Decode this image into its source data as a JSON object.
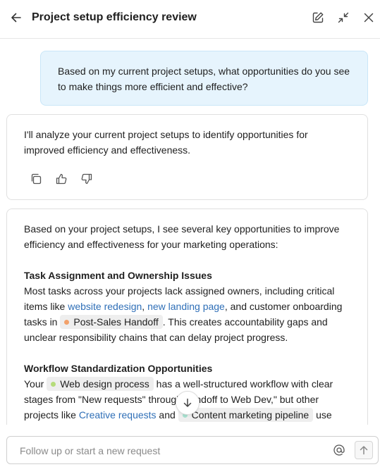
{
  "header": {
    "title": "Project setup efficiency review"
  },
  "user_message": {
    "text": "Based on my current project setups, what opportunities do you see to make things more efficient and effective?"
  },
  "ai_message_1": {
    "text": "I'll analyze your current project setups to identify opportunities for improved efficiency and effectiveness."
  },
  "ai_message_2": {
    "intro": "Based on your project setups, I see several key opportunities to improve efficiency and effectiveness for your marketing operations:",
    "section1": {
      "heading": "Task Assignment and Ownership Issues",
      "t1": "Most tasks across your projects lack assigned owners, including critical items like ",
      "link1": "website redesign",
      "t2": ", ",
      "link2": "new landing page",
      "t3": ", and customer onboarding tasks in ",
      "chip1": "Post-Sales Handoff",
      "t4": ". This creates accountability gaps and unclear responsibility chains that can delay project progress."
    },
    "section2": {
      "heading": "Workflow Standardization Opportunities",
      "t1": "Your ",
      "chip1": "Web design process",
      "t2": " has a well-structured workflow with clear stages from \"New requests\" through handoff to Web Dev,\" but other projects like ",
      "link1": "Creative requests",
      "t3": " and ",
      "chip2": "Content marketing pipeline",
      "t4": " use"
    }
  },
  "composer": {
    "placeholder": "Follow up or start a new request"
  },
  "colors": {
    "user_bubble_bg": "#e6f4fd",
    "link": "#2f6fb7",
    "chip_post_sales_dot": "#f2a16b",
    "chip_web_design_dot": "#b5dc7a",
    "chip_content_dot": "#a8e0cf"
  },
  "icons": {
    "back": "arrow-left-icon",
    "edit": "edit-icon",
    "collapse": "collapse-icon",
    "close": "close-icon",
    "copy": "copy-icon",
    "thumbs_up": "thumbs-up-icon",
    "thumbs_down": "thumbs-down-icon",
    "scroll_down": "arrow-down-icon",
    "mention": "at-sign-icon",
    "send": "arrow-up-icon"
  }
}
